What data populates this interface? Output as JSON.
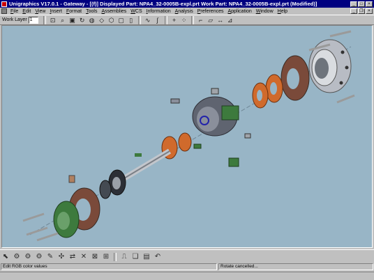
{
  "window": {
    "title": "Unigraphics V17.0.1 - Gateway - [(f)]  Displayed Part: NPA4_32-0005B-expl.prt   Work Part: NPA4_32-0005B-expl.prt (Modified)]",
    "title_bar_color": "#000080",
    "controls": [
      "minimize-icon",
      "maximize-icon",
      "close-icon"
    ]
  },
  "menu": {
    "items": [
      {
        "label": "File"
      },
      {
        "label": "Edit"
      },
      {
        "label": "View"
      },
      {
        "label": "Insert"
      },
      {
        "label": "Format"
      },
      {
        "label": "Tools"
      },
      {
        "label": "Assemblies"
      },
      {
        "label": "WCS"
      },
      {
        "label": "Information"
      },
      {
        "label": "Analysis"
      },
      {
        "label": "Preferences"
      },
      {
        "label": "Application"
      },
      {
        "label": "Window"
      },
      {
        "label": "Help"
      }
    ]
  },
  "toolbar": {
    "work_layer_label": "Work Layer",
    "work_layer_value": "1",
    "icons": [
      "fit-icon",
      "zoom-icon",
      "zoom-window-icon",
      "rotate-icon",
      "shaded-icon",
      "wireframe-icon",
      "hidden-line-icon",
      "front-view-icon",
      "top-view-icon",
      "curve-icon",
      "spline-icon",
      "point-icon",
      "point-set-icon",
      "sketch-icon",
      "datum-plane-icon",
      "dimension-icon",
      "measure-icon"
    ]
  },
  "viewport": {
    "background": "#98b5c6",
    "content": "exploded-assembly-model"
  },
  "bottom_toolbar": {
    "icons": [
      "select-icon",
      "assembly-icon",
      "component-icon",
      "add-component-icon",
      "edit-icon",
      "explode-icon",
      "reposition-icon",
      "delete-icon",
      "unexplode-icon",
      "ref-set-icon",
      "trace-icon",
      "copy-icon",
      "paste-icon",
      "undo-icon"
    ]
  },
  "status": {
    "left": "Edit RGB color values",
    "right": "Rotate cancelled..."
  }
}
